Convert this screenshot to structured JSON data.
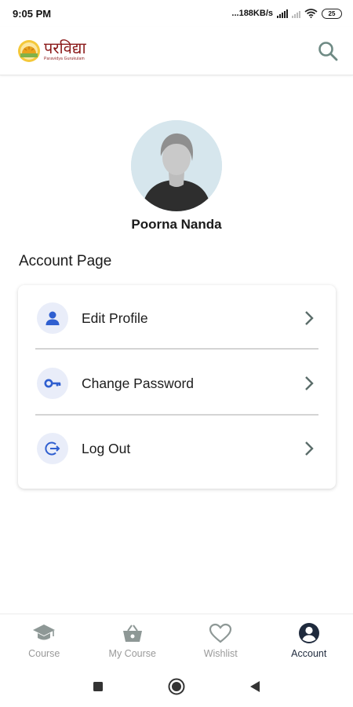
{
  "status_bar": {
    "time": "9:05 PM",
    "network_speed": "...188KB/s",
    "battery": "25",
    "icons": [
      "signal-icon",
      "wifi-icon",
      "battery-icon"
    ]
  },
  "app_bar": {
    "logo_title": "परविद्या",
    "logo_subtitle": "Paravidya Gurukulam",
    "search_icon": "search-icon"
  },
  "profile": {
    "name": "Poorna Nanda"
  },
  "page_title": "Account Page",
  "menu": {
    "items": [
      {
        "label": "Edit Profile",
        "icon": "person-icon"
      },
      {
        "label": "Change Password",
        "icon": "key-icon"
      },
      {
        "label": "Log Out",
        "icon": "logout-icon"
      }
    ]
  },
  "bottom_nav": {
    "items": [
      {
        "label": "Course",
        "icon": "graduation-cap-icon",
        "active": false
      },
      {
        "label": "My Course",
        "icon": "basket-icon",
        "active": false
      },
      {
        "label": "Wishlist",
        "icon": "heart-icon",
        "active": false
      },
      {
        "label": "Account",
        "icon": "account-circle-icon",
        "active": true
      }
    ]
  },
  "colors": {
    "accent": "#2f5fd0",
    "icon_bg": "#e9edf9",
    "active_nav": "#1f2a3d",
    "inactive_nav": "#9a9a9a",
    "logo": "#8b1a1a"
  }
}
